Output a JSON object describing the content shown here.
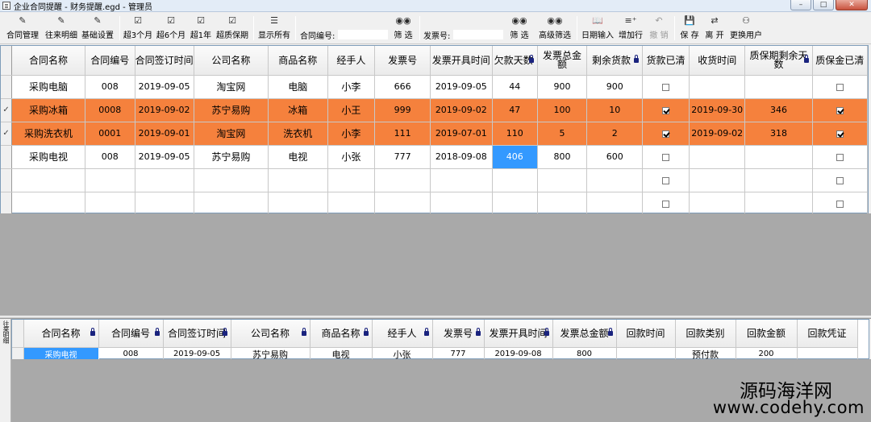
{
  "window": {
    "title": "企业合同提醒 - 财务提醒.egd - 管理员",
    "minimize": "0",
    "maximize": "1",
    "close": "r"
  },
  "toolbar": {
    "items": [
      {
        "label": "合同管理",
        "icon": "edit-icon"
      },
      {
        "label": "往来明细",
        "icon": "edit-icon"
      },
      {
        "label": "基础设置",
        "icon": "edit-icon"
      },
      {
        "label": "超3个月",
        "icon": "check-doc-icon"
      },
      {
        "label": "超6个月",
        "icon": "check-doc-icon"
      },
      {
        "label": "超1年",
        "icon": "check-doc-icon"
      },
      {
        "label": "超质保期",
        "icon": "check-doc-icon"
      },
      {
        "label": "显示所有",
        "icon": "list-icon"
      },
      {
        "label": "筛 选",
        "icon": "binoculars-icon"
      },
      {
        "label": "筛 选",
        "icon": "binoculars-icon"
      },
      {
        "label": "高级筛选",
        "icon": "binoculars-icon"
      },
      {
        "label": "日期输入",
        "icon": "book-icon"
      },
      {
        "label": "增加行",
        "icon": "add-row-icon"
      },
      {
        "label": "撤 销",
        "icon": "undo-icon"
      },
      {
        "label": "保 存",
        "icon": "save-icon"
      },
      {
        "label": "离 开",
        "icon": "exit-icon"
      },
      {
        "label": "更换用户",
        "icon": "user-icon"
      }
    ],
    "contract_no_label": "合同编号:",
    "contract_no_value": "",
    "invoice_no_label": "发票号:",
    "invoice_no_value": ""
  },
  "top_grid": {
    "headers": [
      "合同名称",
      "合同编号",
      "合同签订时间",
      "公司名称",
      "商品名称",
      "经手人",
      "发票号",
      "发票开具时间",
      "欠款天数",
      "发票总金额",
      "剩余货款",
      "货款已清",
      "收货时间",
      "质保期剩余天数",
      "质保金已清"
    ],
    "rows": [
      {
        "marker": "",
        "name": "采购电脑",
        "no": "008",
        "sign_date": "2019-09-05",
        "company": "淘宝网",
        "product": "电脑",
        "handler": "小李",
        "invoice": "666",
        "invoice_date": "2019-09-05",
        "overdue_days": "44",
        "total": "900",
        "remaining": "900",
        "paid": false,
        "receive_date": "",
        "warranty_days": "",
        "deposit_paid": false,
        "style": "normal"
      },
      {
        "marker": "✓",
        "name": "采购冰箱",
        "no": "0008",
        "sign_date": "2019-09-02",
        "company": "苏宁易购",
        "product": "冰箱",
        "handler": "小王",
        "invoice": "999",
        "invoice_date": "2019-09-02",
        "overdue_days": "47",
        "total": "100",
        "remaining": "10",
        "paid": true,
        "receive_date": "2019-09-30",
        "warranty_days": "346",
        "deposit_paid": true,
        "style": "orange"
      },
      {
        "marker": "✓",
        "name": "采购洗衣机",
        "no": "0001",
        "sign_date": "2019-09-01",
        "company": "淘宝网",
        "product": "洗衣机",
        "handler": "小李",
        "invoice": "111",
        "invoice_date": "2019-07-01",
        "overdue_days": "110",
        "total": "5",
        "remaining": "2",
        "paid": true,
        "receive_date": "2019-09-02",
        "warranty_days": "318",
        "deposit_paid": true,
        "style": "orange"
      },
      {
        "marker": "",
        "name": "采购电视",
        "no": "008",
        "sign_date": "2019-09-05",
        "company": "苏宁易购",
        "product": "电视",
        "handler": "小张",
        "invoice": "777",
        "invoice_date": "2018-09-08",
        "overdue_days": "406",
        "total": "800",
        "remaining": "600",
        "paid": false,
        "receive_date": "",
        "warranty_days": "",
        "deposit_paid": false,
        "style": "selected-overdue"
      },
      {
        "marker": "",
        "name": "",
        "no": "",
        "sign_date": "",
        "company": "",
        "product": "",
        "handler": "",
        "invoice": "",
        "invoice_date": "",
        "overdue_days": "",
        "total": "",
        "remaining": "",
        "paid": false,
        "receive_date": "",
        "warranty_days": "",
        "deposit_paid": false,
        "style": "normal"
      },
      {
        "marker": "",
        "name": "",
        "no": "",
        "sign_date": "",
        "company": "",
        "product": "",
        "handler": "",
        "invoice": "",
        "invoice_date": "",
        "overdue_days": "",
        "total": "",
        "remaining": "",
        "paid": false,
        "receive_date": "",
        "warranty_days": "",
        "deposit_paid": false,
        "style": "normal"
      }
    ]
  },
  "side_panel": {
    "label": "往来明细"
  },
  "bottom_grid": {
    "headers": [
      "合同名称",
      "合同编号",
      "合同签订时间",
      "公司名称",
      "商品名称",
      "经手人",
      "发票号",
      "发票开具时间",
      "发票总金额",
      "回款时间",
      "回款类别",
      "回款金额",
      "回款凭证"
    ],
    "rows": [
      {
        "name": "采购电视",
        "no": "008",
        "sign_date": "2019-09-05",
        "company": "苏宁易购",
        "product": "电视",
        "handler": "小张",
        "invoice": "777",
        "invoice_date": "2019-09-08",
        "total": "800",
        "return_date": "",
        "return_type": "预付款",
        "return_amount": "200",
        "voucher": ""
      }
    ]
  },
  "watermark": {
    "line1": "源码海洋网",
    "line2": "www.codehy.com"
  },
  "colors": {
    "overdue_row": "#f5813d",
    "selected_cell": "#3399ff",
    "empty_area": "#a9a9a9"
  }
}
